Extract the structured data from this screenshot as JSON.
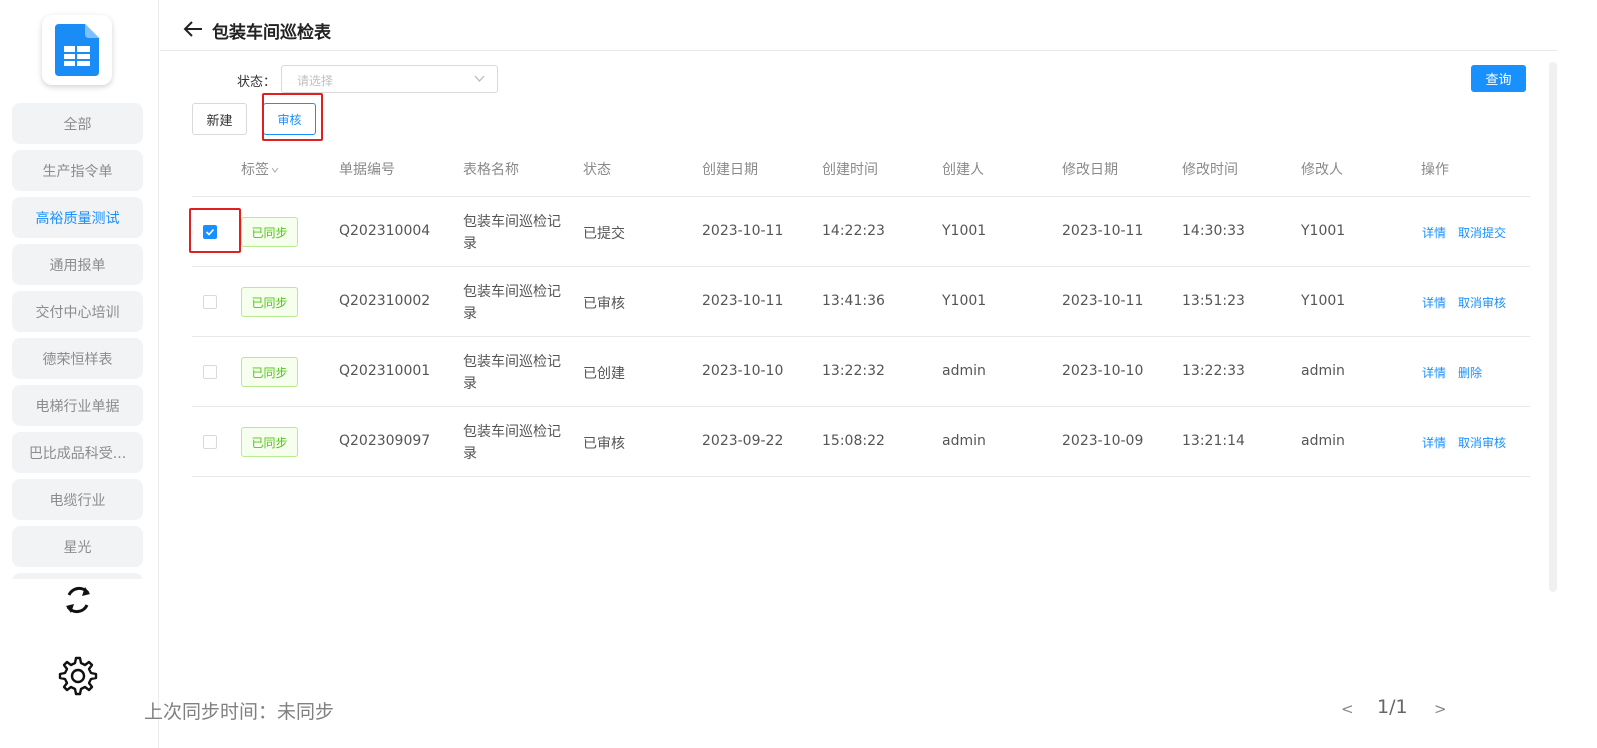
{
  "sidebar": {
    "items": [
      {
        "label": "全部",
        "active": false
      },
      {
        "label": "生产指令单",
        "active": false
      },
      {
        "label": "高裕质量测试",
        "active": true
      },
      {
        "label": "通用报单",
        "active": false
      },
      {
        "label": "交付中心培训",
        "active": false
      },
      {
        "label": "德荣恒样表",
        "active": false
      },
      {
        "label": "电梯行业单据",
        "active": false
      },
      {
        "label": "巴比成品科受...",
        "active": false
      },
      {
        "label": "电缆行业",
        "active": false
      },
      {
        "label": "星光",
        "active": false
      }
    ],
    "sync_status": "上次同步时间：未同步"
  },
  "header": {
    "title": "包装车间巡检表"
  },
  "filter": {
    "status_label": "状态：",
    "status_placeholder": "请选择",
    "query_label": "查询"
  },
  "toolbar": {
    "new_label": "新建",
    "review_label": "审核"
  },
  "table": {
    "columns": [
      "标签",
      "单据编号",
      "表格名称",
      "状态",
      "创建日期",
      "创建时间",
      "创建人",
      "修改日期",
      "修改时间",
      "修改人",
      "操作"
    ],
    "rows": [
      {
        "checked": true,
        "tag": "已同步",
        "code": "Q202310004",
        "name": "包装车间巡检记录",
        "status": "已提交",
        "create_date": "2023-10-11",
        "create_time": "14:22:23",
        "creator": "Y1001",
        "modify_date": "2023-10-11",
        "modify_time": "14:30:33",
        "modifier": "Y1001",
        "op1": "详情",
        "op2": "取消提交"
      },
      {
        "checked": false,
        "tag": "已同步",
        "code": "Q202310002",
        "name": "包装车间巡检记录",
        "status": "已审核",
        "create_date": "2023-10-11",
        "create_time": "13:41:36",
        "creator": "Y1001",
        "modify_date": "2023-10-11",
        "modify_time": "13:51:23",
        "modifier": "Y1001",
        "op1": "详情",
        "op2": "取消审核"
      },
      {
        "checked": false,
        "tag": "已同步",
        "code": "Q202310001",
        "name": "包装车间巡检记录",
        "status": "已创建",
        "create_date": "2023-10-10",
        "create_time": "13:22:32",
        "creator": "admin",
        "modify_date": "2023-10-10",
        "modify_time": "13:22:33",
        "modifier": "admin",
        "op1": "详情",
        "op2": "删除"
      },
      {
        "checked": false,
        "tag": "已同步",
        "code": "Q202309097",
        "name": "包装车间巡检记录",
        "status": "已审核",
        "create_date": "2023-09-22",
        "create_time": "15:08:22",
        "creator": "admin",
        "modify_date": "2023-10-09",
        "modify_time": "13:21:14",
        "modifier": "admin",
        "op1": "详情",
        "op2": "取消审核"
      }
    ]
  },
  "pagination": {
    "prev": "<",
    "text": "1/1",
    "next": ">"
  },
  "colors": {
    "accent": "#1890ff",
    "highlight_box": "#e02020",
    "tag_green": "#52c41a"
  }
}
